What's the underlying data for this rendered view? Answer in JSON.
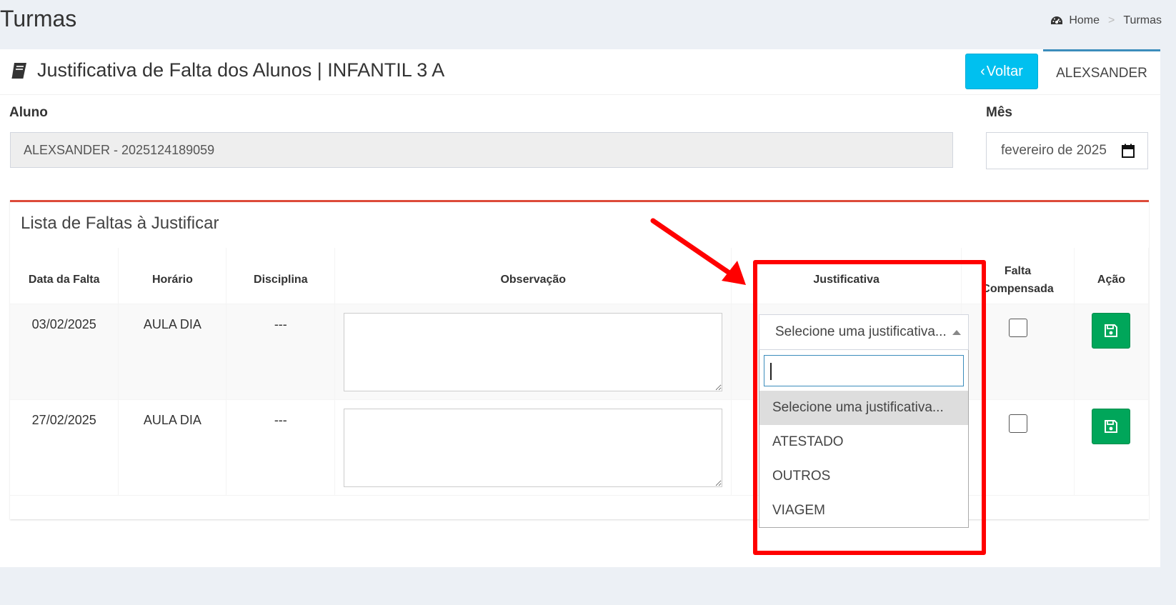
{
  "page": {
    "title": "Turmas",
    "breadcrumb": {
      "home": "Home",
      "separator": ">",
      "current": "Turmas"
    }
  },
  "header": {
    "title": "Justificativa de Falta dos Alunos | INFANTIL 3 A",
    "back_label": "Voltar",
    "user_name": "ALEXSANDER"
  },
  "form": {
    "aluno_label": "Aluno",
    "aluno_value": "ALEXSANDER - 2025124189059",
    "mes_label": "Mês",
    "mes_value": "fevereiro de 2025"
  },
  "list": {
    "title": "Lista de Faltas à Justificar",
    "columns": {
      "data": "Data da Falta",
      "horario": "Horário",
      "disciplina": "Disciplina",
      "observacao": "Observação",
      "justificativa": "Justificativa",
      "falta_line1": "Falta",
      "falta_line2": "Compensada",
      "acao": "Ação"
    },
    "rows": [
      {
        "data": "03/02/2025",
        "horario": "AULA DIA",
        "disciplina": "---"
      },
      {
        "data": "27/02/2025",
        "horario": "AULA DIA",
        "disciplina": "---"
      }
    ]
  },
  "justificativa_select": {
    "selected": "Selecione uma justificativa...",
    "options": [
      "Selecione uma justificativa...",
      "ATESTADO",
      "OUTROS",
      "VIAGEM"
    ]
  },
  "colors": {
    "voltar": "#00c0ef",
    "save": "#00a65a",
    "box_border": "#dd4b39",
    "highlight": "#ff0000"
  }
}
